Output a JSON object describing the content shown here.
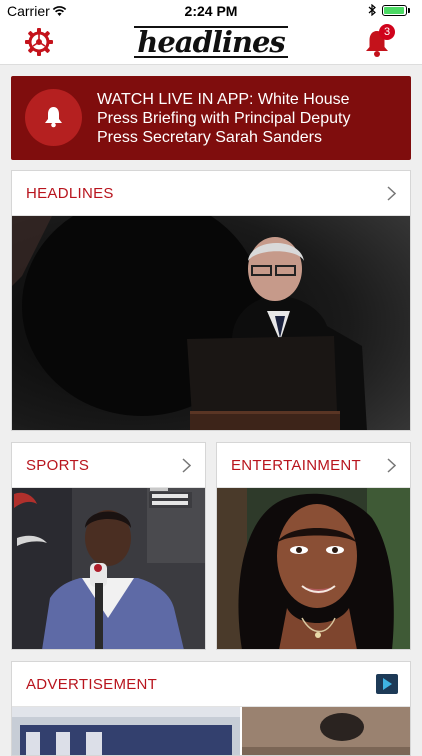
{
  "status_bar": {
    "carrier": "Carrier",
    "time": "2:24 PM",
    "battery_level": 0.95
  },
  "nav": {
    "logo": "headlines",
    "notification_count": "3"
  },
  "live_banner": {
    "text": "WATCH LIVE IN APP: White House Press Briefing with Principal Deputy Press Secretary Sarah Sanders"
  },
  "sections": {
    "headlines": {
      "title": "HEADLINES"
    },
    "sports": {
      "title": "SPORTS"
    },
    "entertainment": {
      "title": "ENTERTAINMENT"
    },
    "advertisement": {
      "title": "ADVERTISEMENT"
    }
  },
  "colors": {
    "accent": "#b8141d",
    "banner": "#7f0d0d",
    "banner_circle": "#b52020"
  }
}
